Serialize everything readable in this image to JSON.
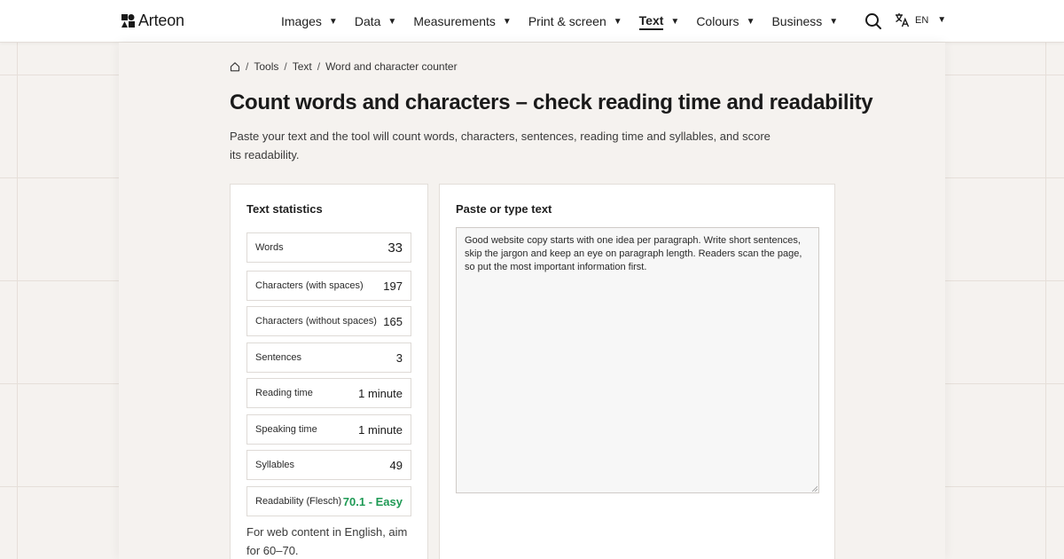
{
  "brand": {
    "name": "Arteon"
  },
  "nav": {
    "items": [
      {
        "label": "Images",
        "active": false
      },
      {
        "label": "Data",
        "active": false
      },
      {
        "label": "Measurements",
        "active": false
      },
      {
        "label": "Print & screen",
        "active": false
      },
      {
        "label": "Text",
        "active": true
      },
      {
        "label": "Colours",
        "active": false
      },
      {
        "label": "Business",
        "active": false
      }
    ],
    "search_icon": "search-icon",
    "language": {
      "icon": "translate-icon",
      "label": "EN"
    }
  },
  "breadcrumb": {
    "home_icon": "home-icon",
    "items": [
      "Tools",
      "Text",
      "Word and character counter"
    ]
  },
  "page": {
    "title": "Count words and characters – check reading time and readability",
    "intro": "Paste your text and the tool will count words, characters, sentences, reading time and syllables, and score its readability."
  },
  "stats": {
    "title": "Text statistics",
    "rows": [
      {
        "label": "Words",
        "value": "33"
      },
      {
        "label": "Characters (with spaces)",
        "value": "197"
      },
      {
        "label": "Characters (without spaces)",
        "value": "165"
      },
      {
        "label": "Sentences",
        "value": "3"
      },
      {
        "label": "Reading time",
        "value": "1 minute"
      },
      {
        "label": "Speaking time",
        "value": "1 minute"
      },
      {
        "label": "Syllables",
        "value": "49"
      },
      {
        "label": "Readability (Flesch)",
        "value": "70.1 - Easy"
      }
    ],
    "note": "For web content in English, aim for 60–70.",
    "good_color": "#1f9a55"
  },
  "input": {
    "label": "Paste or type text",
    "text": "Good website copy starts with one idea per paragraph. Write short sentences, skip the jargon and keep an eye on paragraph length. Readers scan the page, so put the most important information first."
  }
}
